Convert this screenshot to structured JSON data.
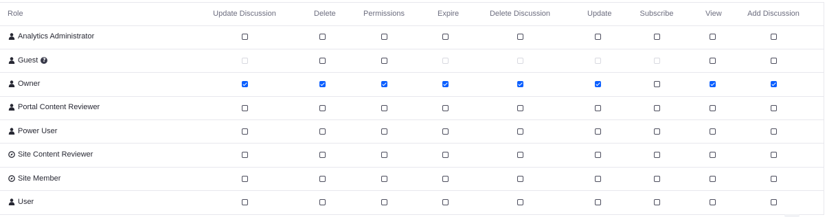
{
  "table": {
    "role_header": "Role",
    "columns": [
      "Update Discussion",
      "Delete",
      "Permissions",
      "Expire",
      "Delete Discussion",
      "Update",
      "Subscribe",
      "View",
      "Add Discussion"
    ],
    "rows": [
      {
        "role": "Analytics Administrator",
        "icon": "user-icon",
        "help": false,
        "perms": [
          "unchecked",
          "unchecked",
          "unchecked",
          "unchecked",
          "unchecked",
          "unchecked",
          "unchecked",
          "unchecked",
          "unchecked"
        ]
      },
      {
        "role": "Guest",
        "icon": "user-icon",
        "help": true,
        "perms": [
          "disabled",
          "unchecked",
          "unchecked",
          "disabled",
          "disabled",
          "disabled",
          "disabled",
          "unchecked",
          "unchecked"
        ]
      },
      {
        "role": "Owner",
        "icon": "user-icon",
        "help": false,
        "perms": [
          "checked",
          "checked",
          "checked",
          "checked",
          "checked",
          "checked",
          "unchecked",
          "checked",
          "checked"
        ]
      },
      {
        "role": "Portal Content Reviewer",
        "icon": "user-icon",
        "help": false,
        "perms": [
          "unchecked",
          "unchecked",
          "unchecked",
          "unchecked",
          "unchecked",
          "unchecked",
          "unchecked",
          "unchecked",
          "unchecked"
        ]
      },
      {
        "role": "Power User",
        "icon": "user-icon",
        "help": false,
        "perms": [
          "unchecked",
          "unchecked",
          "unchecked",
          "unchecked",
          "unchecked",
          "unchecked",
          "unchecked",
          "unchecked",
          "unchecked"
        ]
      },
      {
        "role": "Site Content Reviewer",
        "icon": "compass-icon",
        "help": false,
        "perms": [
          "unchecked",
          "unchecked",
          "unchecked",
          "unchecked",
          "unchecked",
          "unchecked",
          "unchecked",
          "unchecked",
          "unchecked"
        ]
      },
      {
        "role": "Site Member",
        "icon": "compass-icon",
        "help": false,
        "perms": [
          "unchecked",
          "unchecked",
          "unchecked",
          "unchecked",
          "unchecked",
          "unchecked",
          "unchecked",
          "unchecked",
          "unchecked"
        ]
      },
      {
        "role": "User",
        "icon": "user-icon",
        "help": false,
        "perms": [
          "unchecked",
          "unchecked",
          "unchecked",
          "unchecked",
          "unchecked",
          "unchecked",
          "unchecked",
          "unchecked",
          "unchecked"
        ]
      }
    ]
  },
  "colors": {
    "checked": "#0b5fff",
    "border": "#e7e7ed",
    "header_text": "#6b6c7e",
    "body_text": "#272833"
  }
}
